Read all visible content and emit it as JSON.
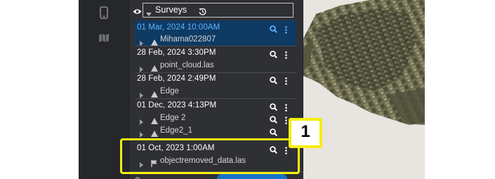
{
  "panel": {
    "title": "Surveys"
  },
  "entries": [
    {
      "date": "01 Mar, 2024 10:00AM",
      "selected": true,
      "items": [
        {
          "type": "mesh",
          "label": "Mihama022807"
        }
      ]
    },
    {
      "date": "28 Feb, 2024 3:30PM",
      "selected": false,
      "items": [
        {
          "type": "mesh",
          "label": "point_cloud.las"
        }
      ]
    },
    {
      "date": "28 Feb, 2024 2:49PM",
      "selected": false,
      "items": [
        {
          "type": "mesh",
          "label": "Edge"
        }
      ]
    },
    {
      "date": "01 Dec, 2023 4:13PM",
      "selected": false,
      "items": [
        {
          "type": "mesh",
          "label": "Edge 2"
        },
        {
          "type": "mesh",
          "label": "Edge2_1"
        }
      ]
    },
    {
      "date": "01 Oct, 2023 1:00AM",
      "selected": false,
      "items": [
        {
          "type": "flag",
          "label": "objectremoved_data.las"
        }
      ]
    }
  ],
  "annotation": {
    "callout_number": "1",
    "highlight_color": "#f6ee12"
  },
  "colors": {
    "selected_date": "#5fb2ff",
    "selected_bg": "#0e3a63",
    "panel_bg": "#2f3034",
    "rail_bg": "#26272b"
  },
  "icons": {
    "rail": [
      "mobile-device-icon",
      "map-icon"
    ],
    "header": [
      "eye-icon",
      "caret-down-icon",
      "history-icon"
    ],
    "row_actions": [
      "zoom-icon",
      "more-vert-icon"
    ]
  }
}
